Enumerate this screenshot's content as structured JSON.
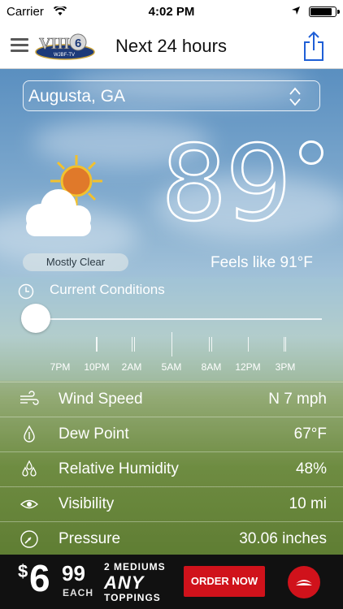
{
  "status_bar": {
    "carrier": "Carrier",
    "time": "4:02 PM"
  },
  "nav": {
    "title": "Next 24 hours",
    "logo_text": "WJBF-TV"
  },
  "location": {
    "value": "Augusta, GA"
  },
  "current": {
    "condition": "Mostly Clear",
    "temperature": "89",
    "feels_like": "Feels like 91°F"
  },
  "timeline": {
    "title": "Current Conditions",
    "labels": [
      "7PM",
      "10PM",
      "2AM",
      "5AM",
      "8AM",
      "12PM",
      "3PM"
    ],
    "position": 0
  },
  "details": [
    {
      "label": "Wind Speed",
      "value": "N 7 mph",
      "icon": "wind-icon"
    },
    {
      "label": "Dew Point",
      "value": "67°F",
      "icon": "dew-point-icon"
    },
    {
      "label": "Relative Humidity",
      "value": "48%",
      "icon": "humidity-icon"
    },
    {
      "label": "Visibility",
      "value": "10 mi",
      "icon": "visibility-icon"
    },
    {
      "label": "Pressure",
      "value": "30.06 inches",
      "icon": "pressure-icon"
    }
  ],
  "ad": {
    "dollar": "$",
    "price_dollars": "6",
    "price_cents": "99",
    "each": "EACH",
    "line1": "2 MEDIUMS",
    "line2": "ANY",
    "line3": "TOPPINGS",
    "cta": "ORDER NOW"
  },
  "colors": {
    "ad_red": "#d0121b",
    "share_blue": "#1f5fd6"
  }
}
